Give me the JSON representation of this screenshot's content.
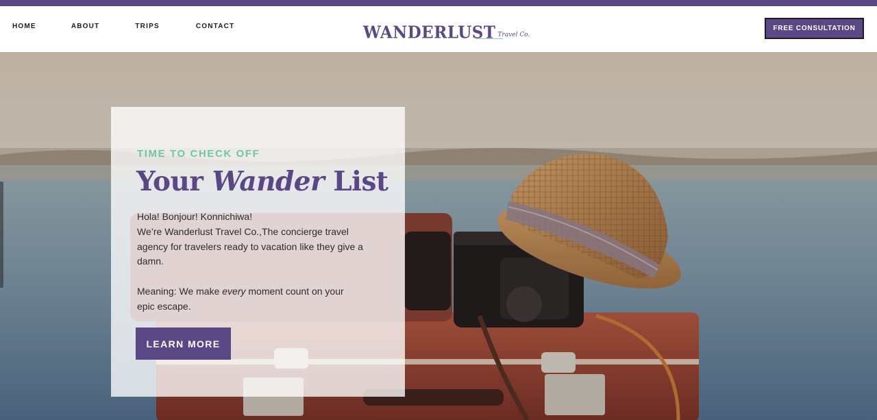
{
  "nav": {
    "items": [
      "HOME",
      "ABOUT",
      "TRIPS",
      "CONTACT"
    ]
  },
  "logo": {
    "main": "WANDERLUST",
    "sub": "Travel Co."
  },
  "cta": {
    "label": "FREE CONSULTATION"
  },
  "hero": {
    "eyebrow": "TIME TO CHECK OFF",
    "headline_pre": "Your ",
    "headline_em": "Wander",
    "headline_post": " List",
    "intro_line1": "Hola! Bonjour! Konnichiwa!",
    "intro_line2": "We’re Wanderlust Travel Co.,The concierge travel agency for travelers ready to vacation like they give a damn.",
    "meaning_pre": "Meaning: We make ",
    "meaning_em": "every",
    "meaning_post": " moment count on your epic escape.",
    "button_label": "LEARN MORE"
  },
  "colors": {
    "brand_purple": "#5a4786",
    "accent_mint": "#6cc9a5",
    "text_dark": "#1b1b1b"
  }
}
